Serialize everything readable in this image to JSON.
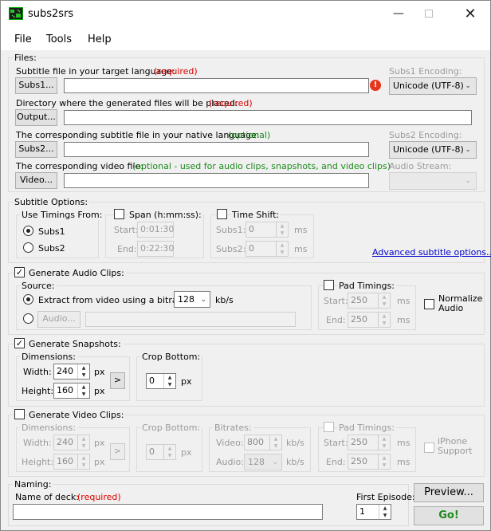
{
  "app_title": "subs2srs",
  "menu": [
    "File",
    "Tools",
    "Help"
  ],
  "files": {
    "legend": "Files:",
    "subs1_label": "Subtitle file in your target language:",
    "subs1_req": "(required)",
    "subs1_button": "Subs1...",
    "subs1_enc_label": "Subs1 Encoding:",
    "subs1_enc_value": "Unicode (UTF-8)",
    "output_label": "Directory where the generated files will be placed:",
    "output_req": "(required)",
    "output_button": "Output...",
    "subs2_label": "The corresponding subtitle file in your native language:",
    "subs2_opt": "(optional)",
    "subs2_button": "Subs2...",
    "subs2_enc_label": "Subs2 Encoding:",
    "subs2_enc_value": "Unicode (UTF-8)",
    "video_label": "The corresponding video file:",
    "video_opt": "(optional - used for audio clips, snapshots, and video clips)",
    "video_button": "Video...",
    "audio_stream_label": "Audio Stream:",
    "audio_stream_value": ""
  },
  "subtitle_options": {
    "legend": "Subtitle Options:",
    "use_timings_legend": "Use Timings From:",
    "subs1": "Subs1",
    "subs2": "Subs2",
    "span_legend": "Span (h:mm:ss):",
    "start_label": "Start:",
    "start_value": "0:01:30",
    "end_label": "End:",
    "end_value": "0:22:30",
    "time_shift_legend": "Time Shift:",
    "ts_subs1_label": "Subs1:",
    "ts_subs1_value": "0",
    "ts_subs2_label": "Subs2:",
    "ts_subs2_value": "0",
    "ms": "ms",
    "advanced_link": "Advanced subtitle options..."
  },
  "audio": {
    "legend": "Generate Audio Clips:",
    "checked": true,
    "source_legend": "Source:",
    "extract_label": "Extract from video using a bitrate of",
    "bitrate_value": "128",
    "kbs": "kb/s",
    "audio_button": "Audio...",
    "pad_legend": "Pad Timings:",
    "start_label": "Start:",
    "start_value": "250",
    "end_label": "End:",
    "end_value": "250",
    "ms": "ms",
    "normalize": "Normalize Audio"
  },
  "snapshots": {
    "legend": "Generate Snapshots:",
    "checked": true,
    "dim_legend": "Dimensions:",
    "width_label": "Width:",
    "width_value": "240",
    "height_label": "Height:",
    "height_value": "160",
    "px": "px",
    "arrow_button": ">",
    "crop_legend": "Crop Bottom:",
    "crop_value": "0"
  },
  "video": {
    "legend": "Generate Video Clips:",
    "checked": false,
    "dim_legend": "Dimensions:",
    "width_label": "Width:",
    "width_value": "240",
    "height_label": "Height:",
    "height_value": "160",
    "px": "px",
    "arrow_button": ">",
    "crop_legend": "Crop Bottom:",
    "crop_value": "0",
    "bitrates_legend": "Bitrates:",
    "video_label": "Video:",
    "video_value": "800",
    "audio_label": "Audio:",
    "audio_value": "128",
    "kbs": "kb/s",
    "pad_legend": "Pad Timings:",
    "start_label": "Start:",
    "start_value": "250",
    "end_label": "End:",
    "end_value": "250",
    "ms": "ms",
    "iphone": "iPhone Support"
  },
  "naming": {
    "legend": "Naming:",
    "deck_label": "Name of deck:",
    "deck_req": "(required)",
    "deck_value": "",
    "first_episode_label": "First Episode:",
    "first_episode_value": "1",
    "preview_button": "Preview...",
    "go_button": "Go!"
  }
}
